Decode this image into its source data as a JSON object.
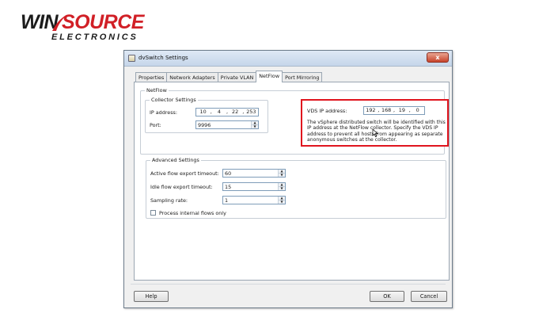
{
  "logo": {
    "win": "WIN",
    "source": "SOURCE",
    "subtitle": "ELECTRONICS",
    "colors": {
      "accent": "#d11f26",
      "dark": "#1c1c1c"
    }
  },
  "window": {
    "title": "dvSwitch Settings",
    "close_label": "x",
    "tabs": [
      {
        "label": "Properties",
        "active": false
      },
      {
        "label": "Network Adapters",
        "active": false
      },
      {
        "label": "Private VLAN",
        "active": false
      },
      {
        "label": "NetFlow",
        "active": true
      },
      {
        "label": "Port Mirroring",
        "active": false
      }
    ],
    "netflow": {
      "legend": "NetFlow",
      "collector": {
        "legend": "Collector Settings",
        "ip_label": "IP address:",
        "ip": [
          "10",
          "4",
          "22",
          "253"
        ],
        "port_label": "Port:",
        "port": "9996"
      },
      "vds": {
        "ip_label": "VDS IP address:",
        "ip": [
          "192",
          "168",
          "19",
          "0"
        ],
        "description": "The vSphere distributed switch will be identified with this IP address at the NetFlow collector. Specify the VDS IP address to prevent all hosts from appearing as separate anonymous switches at the collector.",
        "highlight_color": "#e0151e"
      }
    },
    "advanced": {
      "legend": "Advanced Settings",
      "active_timeout_label": "Active flow export timeout:",
      "active_timeout": "60",
      "idle_timeout_label": "Idle flow export timeout:",
      "idle_timeout": "15",
      "sampling_label": "Sampling rate:",
      "sampling": "1",
      "process_internal_label": "Process internal flows only",
      "process_internal_checked": false
    },
    "buttons": {
      "help": "Help",
      "ok": "OK",
      "cancel": "Cancel"
    }
  }
}
